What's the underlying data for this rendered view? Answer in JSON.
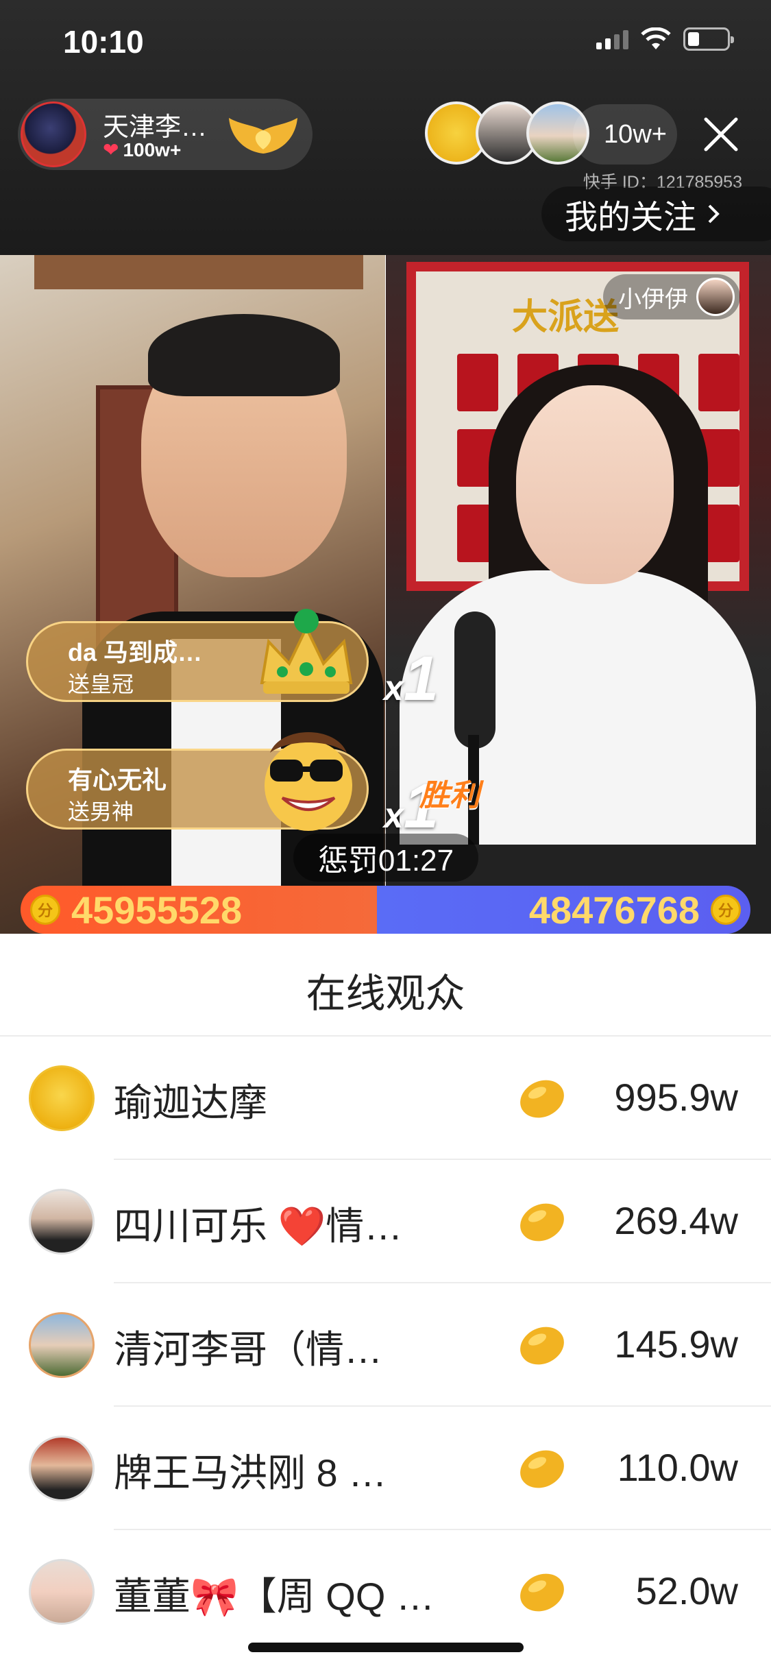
{
  "status_bar": {
    "time": "10:10"
  },
  "header": {
    "host_name": "天津李…",
    "host_likes": "100w+",
    "viewer_count": "10w+",
    "kuaishou_id": "快手 ID：121785953",
    "follow_label": "我的关注"
  },
  "video": {
    "board_text": "大派送",
    "opponent_name": "小伊伊",
    "gifts": [
      {
        "sender": "da 马到成…",
        "action": "送皇冠",
        "count_x": "x",
        "count_n": "1"
      },
      {
        "sender": "有心无礼",
        "action": "送男神",
        "count_x": "x",
        "count_n": "1"
      }
    ],
    "win_badge": "胜利",
    "punish_timer": "惩罚01:27",
    "pk_left_score": "45955528",
    "pk_right_score": "48476768",
    "coin_glyph": "分"
  },
  "audience": {
    "title": "在线观众",
    "rows": [
      {
        "name": "瑜迦达摩",
        "score": "995.9w"
      },
      {
        "name": "四川可乐 ❤️情…",
        "score": "269.4w"
      },
      {
        "name": "清河李哥（情…",
        "score": "145.9w"
      },
      {
        "name": "牌王马洪刚 8 …",
        "score": "110.0w"
      },
      {
        "name": "董董🎀【周 QQ …",
        "score": "52.0w"
      }
    ]
  },
  "colors": {
    "pk_left": "#ff5a2a",
    "pk_right": "#5b5ff0",
    "score_yellow": "#ffd96a",
    "heart": "#ff3b57"
  },
  "icons": [
    "wifi-icon",
    "battery-icon",
    "signal-icon",
    "close-icon",
    "chevron-right-icon",
    "heart-icon",
    "wings-icon",
    "crown-icon",
    "bean-icon",
    "coin-icon"
  ]
}
